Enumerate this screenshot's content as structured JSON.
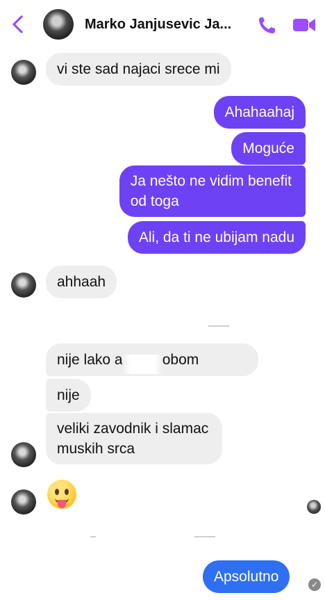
{
  "header": {
    "contact_name": "Marko Janjusevic Ja..."
  },
  "colors": {
    "accent": "#6d42f5",
    "incoming_bubble": "#eeeeef",
    "blue_bubble": "#2f6ff1",
    "icon_purple": "#9b4dff"
  },
  "icons": {
    "back": "chevron-left-icon",
    "call": "phone-icon",
    "video": "video-camera-icon",
    "emoji": "face-with-tongue-emoji",
    "read_status": "check-circle-icon"
  },
  "messages": [
    {
      "from": "contact",
      "text": "vi ste sad najaci srece mi"
    },
    {
      "from": "me",
      "text": "Ahahaahaj"
    },
    {
      "from": "me",
      "text": "Moguće"
    },
    {
      "from": "me",
      "lines": [
        "Ja nešto ne vidim benefit",
        "od toga"
      ]
    },
    {
      "from": "me",
      "text": "Ali, da ti ne ubijam nadu"
    },
    {
      "from": "contact",
      "text": "ahhaah"
    },
    {
      "from": "contact",
      "text": "nije lako a       u sa tobom"
    },
    {
      "from": "contact",
      "text": "nije"
    },
    {
      "from": "contact",
      "lines": [
        "veliki zavodnik i slamac",
        "muskih srca"
      ]
    },
    {
      "from": "contact",
      "emoji": "😛"
    },
    {
      "from": "me",
      "text": "Apsolutno"
    }
  ]
}
